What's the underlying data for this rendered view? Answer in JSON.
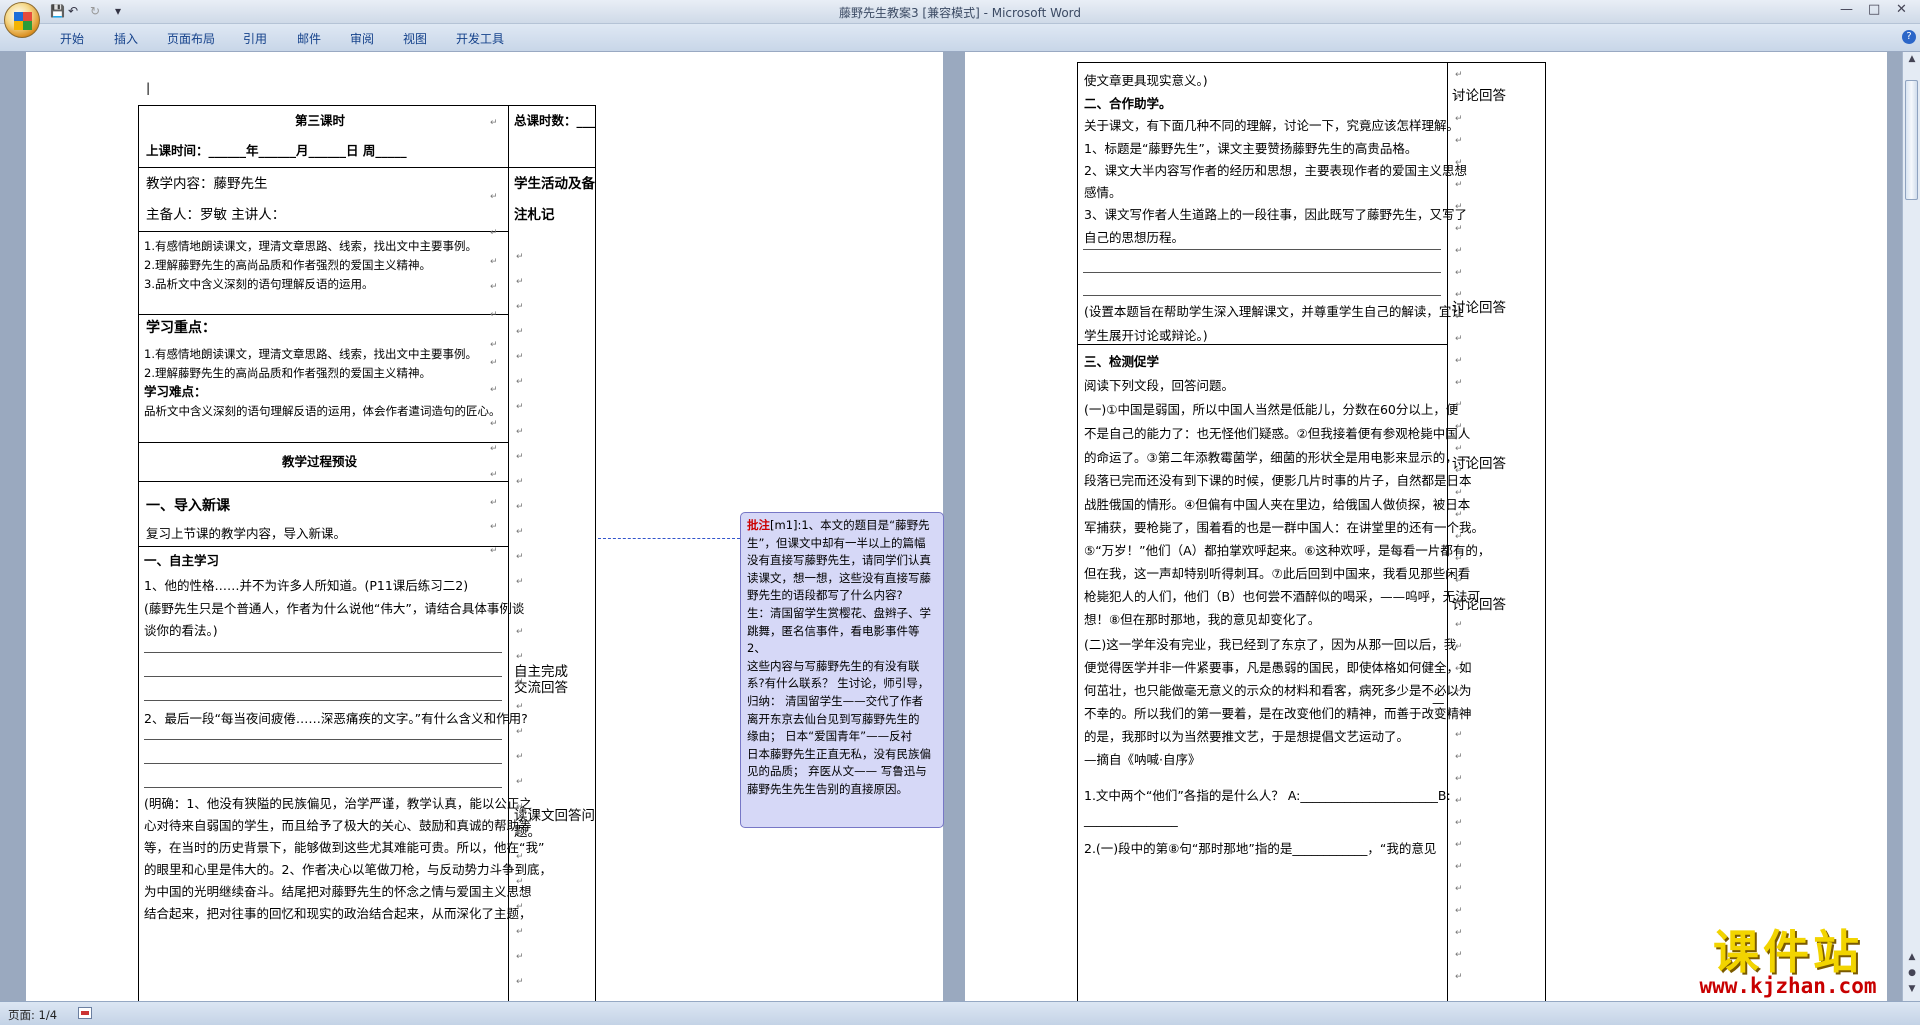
{
  "window": {
    "title": "藤野先生教案3 [兼容模式] - Microsoft Word",
    "controls": [
      "—",
      "□",
      "✕"
    ]
  },
  "qat": {
    "save": "💾",
    "undo": "↶",
    "redo": "↻",
    "more": "▾"
  },
  "ribbon": {
    "tabs": [
      "开始",
      "插入",
      "页面布局",
      "引用",
      "邮件",
      "审阅",
      "视图",
      "开发工具"
    ],
    "help": "?"
  },
  "status": {
    "page": "页面: 1/4"
  },
  "watermark": {
    "big": "课件站",
    "small": "www.kjzhan.com"
  },
  "page1": {
    "cursor": "|",
    "c1": "第三课时",
    "c1b": "上课时间：______年______月______日  周_____",
    "c2": "总课时数：___",
    "c3": "教学内容：藤野先生",
    "c3b": "主备人：罗敏    主讲人：",
    "c4a": "学生活动及备",
    "c4b": "注札记",
    "g1": "1.有感情地朗读课文，理清文章思路、线索，找出文中主要事例。",
    "g2": "2.理解藤野先生的高尚品质和作者强烈的爱国主义精神。",
    "g3": "3.品析文中含义深刻的语句理解反语的运用。",
    "k_title": "学习重点：",
    "k1": "1.有感情地朗读课文，理清文章思路、线索，找出文中主要事例。",
    "k2": "2.理解藤野先生的高尚品质和作者强烈的爱国主义精神。",
    "d_title": "学习难点：",
    "d1": "品析文中含义深刻的语句理解反语的运用，体会作者遣词造句的匠心。",
    "proc": "教学过程预设",
    "s1": "一、导入新课",
    "s1t": "复习上节课的教学内容，导入新课。",
    "s2": "一、自主学习",
    "q1": "1、他的性格……并不为许多人所知道。(P11课后练习二2)",
    "q1b": "(藤野先生只是个普通人，作者为什么说他“伟大”，请结合具体事例谈",
    "q1c": "谈你的看法。)",
    "q2": "2、最后一段“每当夜间疲倦……深恶痛疾的文字。”有什么含义和作用?",
    "ans": [
      "(明确：1、他没有狭隘的民族偏见，治学严谨，教学认真，能以公正之",
      "心对待来自弱国的学生，而且给予了极大的关心、鼓励和真诚的帮助等",
      "等，在当时的历史背景下，能够做到这些尤其难能可贵。所以，他在“我”",
      "的眼里和心里是伟大的。2、作者决心以笔做刀枪，与反动势力斗争到底，",
      "为中国的光明继续奋斗。结尾把对藤野先生的怀念之情与爱国主义思想",
      "结合起来，把对往事的回忆和现实的政治结合起来，从而深化了主题，"
    ],
    "r1": "自主完成",
    "r1b": "交流回答",
    "r2": "读课文回答问",
    "r2b": "题。"
  },
  "comment": {
    "label": "批注",
    "lines": [
      "[m1]:1、本文的题目是“藤野先",
      "生”，但课文中却有一半以上的篇幅",
      "没有直接写藤野先生，请同学们认真",
      "读课文，想一想，这些没有直接写藤",
      "野先生的语段都写了什么内容?",
      "生：清国留学生赏樱花、盘辫子、学",
      "跳舞，匿名信事件，看电影事件等 2、",
      "这些内容与写藤野先生的有没有联",
      "系?有什么联系？ 生讨论，师引导，",
      "归纳：  清国留学生——交代了作者",
      "离开东京去仙台见到写藤野先生的",
      "缘由；  日本“爱国青年”——反衬",
      "日本藤野先生正直无私，没有民族偏",
      "见的品质；  弃医从文——  写鲁迅与",
      "藤野先生先生告别的直接原因。"
    ]
  },
  "page2": {
    "l": [
      "使文章更具现实意义。)",
      "二、合作助学。",
      "关于课文，有下面几种不同的理解，讨论一下，究竟应该怎样理解。",
      "1、标题是“藤野先生”，课文主要赞扬藤野先生的高贵品格。",
      "2、课文大半内容写作者的经历和思想，主要表现作者的爱国主义思想",
      "感情。",
      "3、课文写作者人生道路上的一段往事，因此既写了藤野先生，又写了",
      "自己的思想历程。",
      "(设置本题旨在帮助学生深入理解课文，并尊重学生自己的解读，宜让",
      "学生展开讨论或辩论。)",
      "三、检测促学",
      "阅读下列文段，回答问题。",
      "(一)①中国是弱国，所以中国人当然是低能儿，分数在60分以上，便",
      "不是自己的能力了：也无怪他们疑惑。②但我接着便有参观枪毙中国人",
      "的命运了。③第二年添教霉菌学，细菌的形状全是用电影来显示的，一",
      "段落已完而还没有到下课的时候，便影几片时事的片子，自然都是日本",
      "战胜俄国的情形。④但偏有中国人夹在里边，给俄国人做侦探，被日本",
      "军捕获，要枪毙了，围着看的也是一群中国人：在讲堂里的还有一个我。",
      "⑤“万岁！”他们（A）都拍掌欢呼起来。⑥这种欢呼，是每看一片都有的，",
      "但在我，这一声却特别听得刺耳。⑦此后回到中国来，我看见那些闲看",
      "枪毙犯人的人们，他们（B）也何尝不酒醉似的喝采，——呜呼，无法可",
      "想！⑧但在那时那地，我的意见却变化了。",
      "(二)这一学年没有完业，我已经到了东京了，因为从那一回以后，我",
      "便觉得医学并非一件紧要事，凡是愚弱的国民，即使体格如何健全，如",
      "何茁壮，也只能做毫无意义的示众的材料和看客，病死多少是不必以为",
      "不幸的。所以我们的第一要着，是在改变他们的精神，而善于改变精神",
      "的是，我那时以为当然要推文艺，于是想提倡文艺运动了。",
      "—摘自《呐喊·自序》",
      "1.文中两个“他们”各指的是什么人？ A:______________________B:",
      "_______________",
      "2.(一)段中的第⑧句“那时那地”指的是____________，“我的意见"
    ],
    "dash": "—",
    "r": "讨论回答"
  }
}
